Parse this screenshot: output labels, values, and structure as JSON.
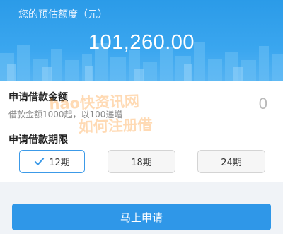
{
  "hero": {
    "label": "您的预估额度（元）",
    "amount": "101,260.00"
  },
  "loan_amount": {
    "title": "申请借款金额",
    "hint": "借款金额1000起，以100递增",
    "value": "0"
  },
  "loan_term": {
    "title": "申请借款期限",
    "options": [
      "12期",
      "18期",
      "24期"
    ],
    "selected": "12期"
  },
  "watermark": {
    "line1": "hao快资讯网",
    "line2": "如何注册借"
  },
  "submit": {
    "label": "马上申请"
  },
  "colors": {
    "primary": "#2f97e8",
    "hero": "#3aa6ef",
    "selected_border": "#3c9ae8"
  }
}
